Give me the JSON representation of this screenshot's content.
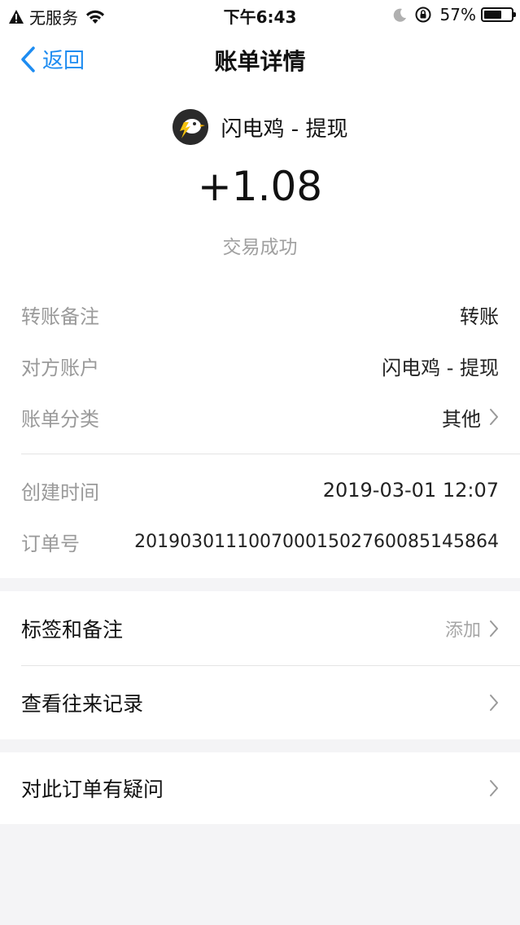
{
  "status_bar": {
    "carrier": "无服务",
    "time": "下午6:43",
    "battery": "57%"
  },
  "nav": {
    "back_label": "返回",
    "title": "账单详情"
  },
  "summary": {
    "merchant": "闪电鸡 - 提现",
    "amount": "+1.08",
    "status": "交易成功"
  },
  "details": [
    {
      "label": "转账备注",
      "value": "转账"
    },
    {
      "label": "对方账户",
      "value": "闪电鸡 - 提现"
    },
    {
      "label": "账单分类",
      "value": "其他"
    },
    {
      "label": "创建时间",
      "value": "2019-03-01 12:07"
    },
    {
      "label": "订单号",
      "value": "2019030111007000150276008514586​4"
    }
  ],
  "actions": {
    "tags": {
      "label": "标签和备注",
      "hint": "添加"
    },
    "history": {
      "label": "查看往来记录"
    },
    "question": {
      "label": "对此订单有疑问"
    }
  },
  "colors": {
    "accent": "#1e8cf1",
    "muted": "#9a9a9a"
  }
}
